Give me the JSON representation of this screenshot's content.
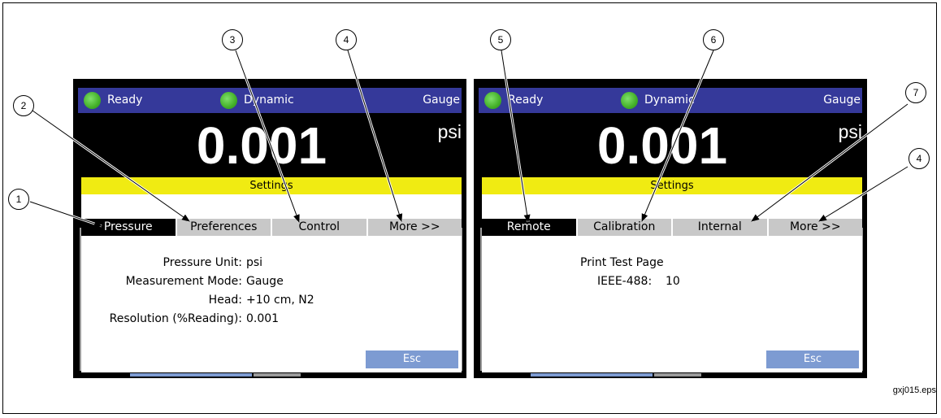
{
  "left_screen": {
    "status": {
      "ready": "Ready",
      "mode": "Dynamic",
      "type": "Gauge"
    },
    "reading": "0.001",
    "unit": "psi",
    "menu_title": "Settings",
    "tabs": [
      "Pressure",
      "Preferences",
      "Control",
      "More >>"
    ],
    "active_tab": "Pressure",
    "rows": [
      {
        "label": "Pressure Unit:",
        "value": "psi"
      },
      {
        "label": "Measurement Mode:",
        "value": "Gauge"
      },
      {
        "label": "Head:",
        "value": "+10 cm, N2"
      },
      {
        "label": "Resolution (%Reading):",
        "value": "0.001"
      }
    ],
    "esc_label": "Esc"
  },
  "right_screen": {
    "status": {
      "ready": "Ready",
      "mode": "Dynamic",
      "type": "Gauge"
    },
    "reading": "0.001",
    "unit": "psi",
    "menu_title": "Settings",
    "tabs": [
      "Remote",
      "Calibration",
      "Internal",
      "More >>"
    ],
    "active_tab": "Remote",
    "print_test_page": "Print Test Page",
    "ieee_label": "IEEE-488:",
    "ieee_value": "10",
    "esc_label": "Esc"
  },
  "callouts": [
    "1",
    "2",
    "3",
    "4",
    "5",
    "6",
    "7",
    "4"
  ],
  "caption": "gxj015.eps",
  "colors": {
    "status_bar": "#35399a",
    "led_green": "#43b028",
    "settings_bar": "#f0eb12",
    "tab_inactive": "#c8c8c8",
    "tab_active": "#000000",
    "esc_button": "#7d9bd2"
  }
}
